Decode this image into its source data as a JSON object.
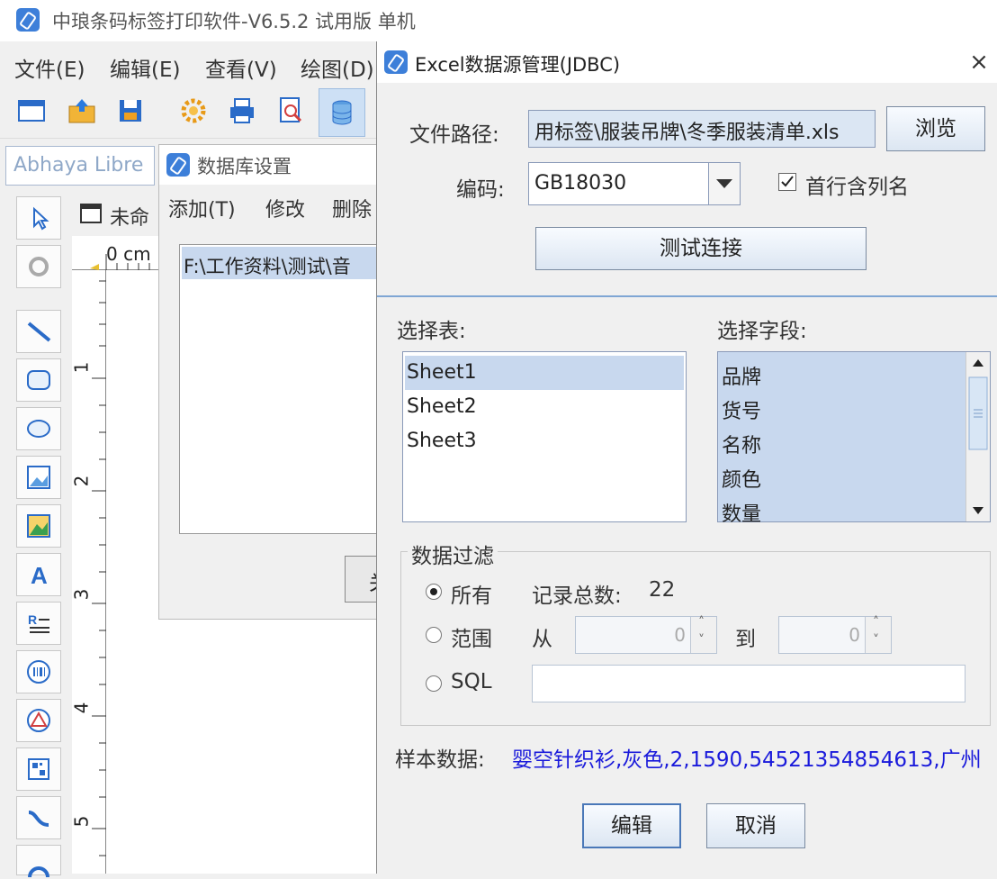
{
  "app": {
    "title": "中琅条码标签打印软件-V6.5.2 试用版 单机",
    "menu": [
      "文件(E)",
      "编辑(E)",
      "查看(V)",
      "绘图(D)"
    ],
    "font_name": "Abhaya Libre",
    "doc_tab": "未命",
    "ruler_unit": "0 cm",
    "ruler_marks": [
      "1",
      "2",
      "3",
      "4",
      "5"
    ]
  },
  "db_dialog": {
    "title": "数据库设置",
    "menu": [
      "添加(T)",
      "修改",
      "删除"
    ],
    "list_item": "F:\\工作资料\\测试\\音",
    "button": "关"
  },
  "excel_dialog": {
    "title": "Excel数据源管理(JDBC)",
    "close": "×",
    "file_path_label": "文件路径:",
    "file_path_value": "用标签\\服装吊牌\\冬季服装清单.xls",
    "browse_label": "浏览",
    "encoding_label": "编码:",
    "encoding_value": "GB18030",
    "header_checkbox_label": "首行含列名",
    "header_checkbox_checked": true,
    "test_label": "测试连接",
    "select_table_label": "选择表:",
    "tables": [
      "Sheet1",
      "Sheet2",
      "Sheet3"
    ],
    "selected_table": "Sheet1",
    "select_field_label": "选择字段:",
    "fields": [
      "品牌",
      "货号",
      "名称",
      "颜色",
      "数量"
    ],
    "filter_group_label": "数据过滤",
    "filter_all_label": "所有",
    "record_count_label": "记录总数:",
    "record_count": "22",
    "filter_range_label": "范围",
    "from_label": "从",
    "from_value": "0",
    "to_label": "到",
    "to_value": "0",
    "filter_sql_label": "SQL",
    "sql_value": "",
    "sample_label": "样本数据:",
    "sample_value": "婴空针织衫,灰色,2,1590,54521354854613,广州",
    "edit_label": "编辑",
    "cancel_label": "取消",
    "colors": {
      "sample_text": "#1a1adb",
      "selection": "#c8d8ee"
    }
  }
}
